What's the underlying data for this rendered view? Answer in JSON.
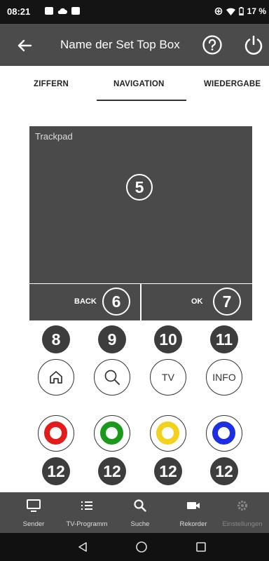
{
  "status_bar": {
    "time": "08:21",
    "battery": "17 %"
  },
  "app_bar": {
    "title": "Name der Set Top Box"
  },
  "tabs": [
    {
      "label": "ZIFFERN"
    },
    {
      "label": "NAVIGATION",
      "active": true
    },
    {
      "label": "WIEDERGABE"
    }
  ],
  "trackpad": {
    "label": "Trackpad",
    "badge": "5"
  },
  "nav_buttons": {
    "back": {
      "label": "BACK",
      "badge": "6"
    },
    "ok": {
      "label": "OK",
      "badge": "7"
    }
  },
  "function_badges": [
    "8",
    "9",
    "10",
    "11"
  ],
  "function_buttons": [
    {
      "name": "home",
      "icon": "home-icon"
    },
    {
      "name": "search",
      "icon": "search-icon"
    },
    {
      "name": "tv",
      "label": "TV"
    },
    {
      "name": "info",
      "label": "INFO"
    }
  ],
  "color_buttons": [
    {
      "name": "red",
      "color": "#e31b1b"
    },
    {
      "name": "green",
      "color": "#1a9a1a"
    },
    {
      "name": "yellow",
      "color": "#f3d21b"
    },
    {
      "name": "blue",
      "color": "#1b2ee3"
    }
  ],
  "color_badges": [
    "12",
    "12",
    "12",
    "12"
  ],
  "bottom_nav": [
    {
      "label": "Sender",
      "icon": "monitor-icon"
    },
    {
      "label": "TV-Programm",
      "icon": "list-icon"
    },
    {
      "label": "Suche",
      "icon": "search-icon"
    },
    {
      "label": "Rekorder",
      "icon": "camera-icon"
    },
    {
      "label": "Einstellungen",
      "icon": "gear-icon",
      "disabled": true
    }
  ],
  "colors": {
    "app_bar": "#4b4b4b",
    "pad": "#4a4a4a",
    "badge": "#3d3d3d"
  }
}
